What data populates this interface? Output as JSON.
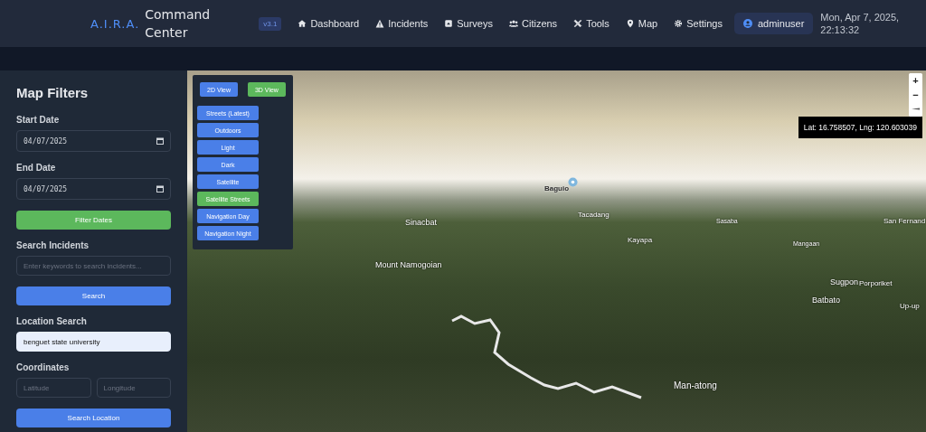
{
  "header": {
    "logo": "A.I.R.A.",
    "title": "Command Center",
    "version": "v3.1",
    "nav": [
      {
        "label": "Dashboard"
      },
      {
        "label": "Incidents"
      },
      {
        "label": "Surveys"
      },
      {
        "label": "Citizens"
      },
      {
        "label": "Tools"
      },
      {
        "label": "Map"
      },
      {
        "label": "Settings"
      }
    ],
    "user": "adminuser",
    "date": "Mon, Apr 7, 2025,",
    "time": "22:13:32"
  },
  "sidebar": {
    "title": "Map Filters",
    "fields": [
      {
        "kind": "date",
        "label": "Start Date",
        "value": "04/07/2025"
      },
      {
        "kind": "date",
        "label": "End Date",
        "value": "04/07/2025"
      },
      {
        "kind": "button",
        "label": "Filter Dates",
        "color": "#5cb85c"
      },
      {
        "kind": "text",
        "label": "Search Incidents",
        "placeholder": "Enter keywords to search incidents..."
      },
      {
        "kind": "button",
        "label": "Search",
        "color": "#4a7fe8"
      },
      {
        "kind": "text",
        "label": "Location Search",
        "value": "benguet state university",
        "highlighted": true
      },
      {
        "kind": "pair",
        "label": "Coordinates",
        "placeholders": [
          "Latitude",
          "Longitude"
        ]
      },
      {
        "kind": "button",
        "label": "Search Location",
        "color": "#4a7fe8"
      }
    ]
  },
  "map": {
    "view_modes": [
      {
        "label": "2D View",
        "selected": false
      },
      {
        "label": "3D View",
        "selected": true
      }
    ],
    "styles": [
      {
        "label": "Streets (Latest)",
        "selected": false
      },
      {
        "label": "Outdoors",
        "selected": false
      },
      {
        "label": "Light",
        "selected": false
      },
      {
        "label": "Dark",
        "selected": false
      },
      {
        "label": "Satellite",
        "selected": false
      },
      {
        "label": "Satellite Streets",
        "selected": true
      },
      {
        "label": "Navigation Day",
        "selected": false
      },
      {
        "label": "Navigation Night",
        "selected": false
      }
    ],
    "zoom_controls": [
      "+",
      "−"
    ],
    "coordinates": "Lat: 16.758507, Lng: 120.603039",
    "labels": [
      "Baguio",
      "Sinacbat",
      "Tacadang",
      "Kayapa",
      "Sasaba",
      "Mangaan",
      "Mount Namogoian",
      "Sugpon",
      "Porporiket",
      "Batbato",
      "San Fernand",
      "Up-up",
      "Man-atong"
    ]
  }
}
